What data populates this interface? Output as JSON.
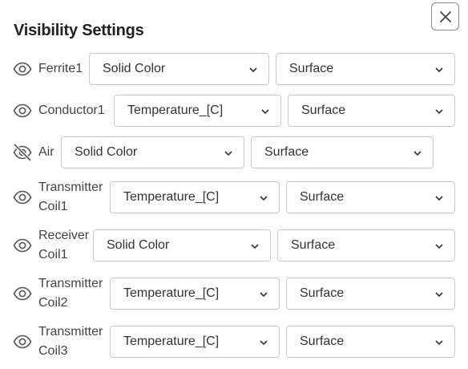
{
  "dialog": {
    "title": "Visibility Settings",
    "close_icon": "close-icon"
  },
  "rows": [
    {
      "label": "Ferrite1",
      "visible": true,
      "color_mode": "Solid Color",
      "display": "Surface"
    },
    {
      "label": "Conductor1",
      "visible": true,
      "color_mode": "Temperature_[C]",
      "display": "Surface"
    },
    {
      "label": "Air",
      "visible": false,
      "color_mode": "Solid Color",
      "display": "Surface"
    },
    {
      "label_line1": "Transmitter",
      "label_line2": "Coil1",
      "visible": true,
      "color_mode": "Temperature_[C]",
      "display": "Surface"
    },
    {
      "label_line1": "Receiver",
      "label_line2": "Coil1",
      "visible": true,
      "color_mode": "Solid Color",
      "display": "Surface"
    },
    {
      "label_line1": "Transmitter",
      "label_line2": "Coil2",
      "visible": true,
      "color_mode": "Temperature_[C]",
      "display": "Surface"
    },
    {
      "label_line1": "Transmitter",
      "label_line2": "Coil3",
      "visible": true,
      "color_mode": "Temperature_[C]",
      "display": "Surface"
    }
  ]
}
